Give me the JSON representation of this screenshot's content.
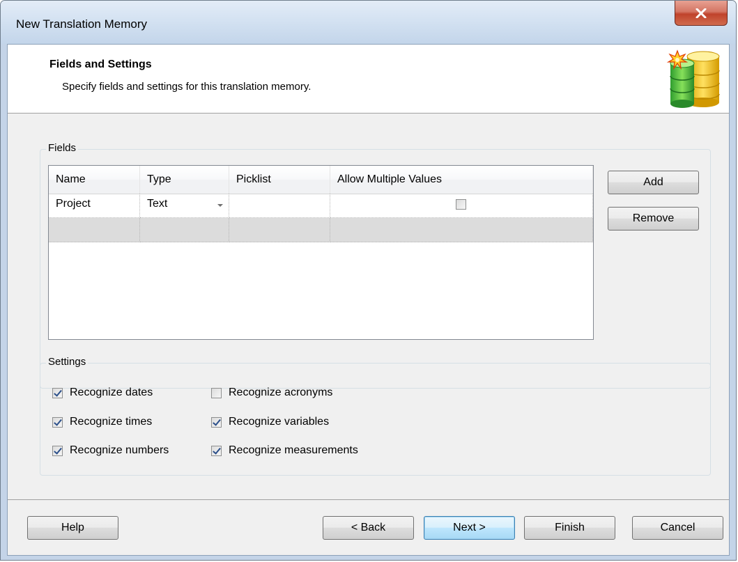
{
  "window": {
    "title": "New Translation Memory"
  },
  "header": {
    "title": "Fields and Settings",
    "subtitle": "Specify fields and settings for this translation memory.",
    "icon": "database-new-icon"
  },
  "fields": {
    "legend": "Fields",
    "columns": [
      "Name",
      "Type",
      "Picklist",
      "Allow Multiple Values"
    ],
    "rows": [
      {
        "name": "Project",
        "type": "Text",
        "picklist": "",
        "allow_multiple": false
      }
    ],
    "add_label": "Add",
    "remove_label": "Remove"
  },
  "settings": {
    "legend": "Settings",
    "options": [
      {
        "label": "Recognize dates",
        "checked": true
      },
      {
        "label": "Recognize times",
        "checked": true
      },
      {
        "label": "Recognize numbers",
        "checked": true
      },
      {
        "label": "Recognize acronyms",
        "checked": false
      },
      {
        "label": "Recognize variables",
        "checked": true
      },
      {
        "label": "Recognize measurements",
        "checked": true
      }
    ]
  },
  "footer": {
    "help_label": "Help",
    "back_label": "< Back",
    "next_label": "Next >",
    "finish_label": "Finish",
    "cancel_label": "Cancel"
  },
  "colors": {
    "title_bar": "#d4e2f2",
    "close_button": "#c0432c",
    "default_button_border": "#3c7fb1",
    "checkmark": "#2b4f8a",
    "new_row": "#dcdcdc"
  }
}
